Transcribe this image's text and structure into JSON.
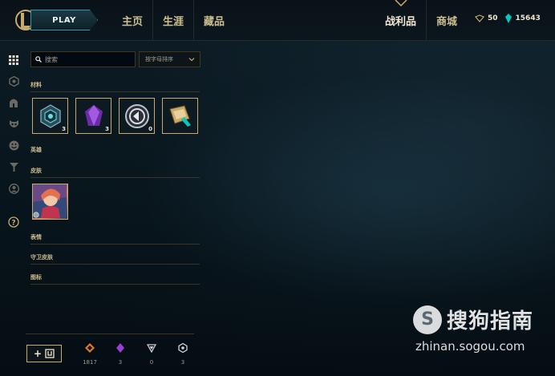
{
  "topbar": {
    "play_label": "PLAY",
    "nav_left": [
      "主页",
      "生涯",
      "藏品"
    ],
    "nav_right": [
      "战利品",
      "商城"
    ],
    "active_nav": "战利品",
    "currency": {
      "rp": "50",
      "be": "15643"
    }
  },
  "rail": {
    "icons": [
      "grid-icon",
      "loot-chest-icon",
      "helmet-icon",
      "mask-icon",
      "emote-icon",
      "ward-icon",
      "profile-icon",
      "help-icon"
    ]
  },
  "panel": {
    "search_placeholder": "搜索",
    "sort_label": "按字母排序",
    "sections": {
      "materials": "材料",
      "champions": "英雄",
      "skins": "皮肤",
      "emotes": "表情",
      "ward_skins": "守卫皮肤",
      "icons": "图标"
    },
    "materials": [
      {
        "name": "hextech-chest",
        "count": "3"
      },
      {
        "name": "mythic-essence",
        "count": "3"
      },
      {
        "name": "orange-essence",
        "count": "0"
      },
      {
        "name": "key",
        "count": ""
      }
    ]
  },
  "bottom": {
    "add_label": "+",
    "currencies": [
      {
        "icon": "orange-essence-icon",
        "value": "1817",
        "color": "#e07a2a"
      },
      {
        "icon": "mythic-essence-icon",
        "value": "3",
        "color": "#9a3fd6"
      },
      {
        "icon": "gemstone-icon",
        "value": "0",
        "color": "#c9c9d4"
      },
      {
        "icon": "token-icon",
        "value": "3",
        "color": "#d0d6da"
      }
    ]
  },
  "watermark": {
    "brand": "搜狗指南",
    "url": "zhinan.sogou.com",
    "logo_letter": "S"
  },
  "colors": {
    "gold": "#c8aa6e",
    "accent": "#0ac8b9",
    "bg": "#071017"
  }
}
